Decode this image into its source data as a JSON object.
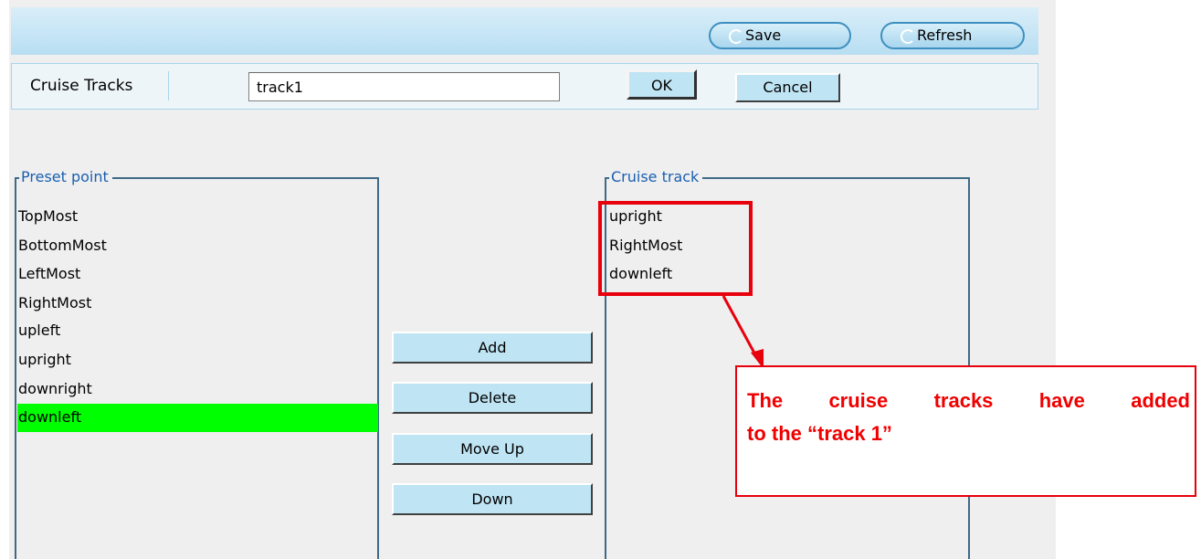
{
  "toolbar": {
    "save_label": "Save",
    "refresh_label": "Refresh"
  },
  "track_row": {
    "label": "Cruise Tracks",
    "input_value": "track1",
    "ok_label": "OK",
    "cancel_label": "Cancel"
  },
  "preset": {
    "legend": "Preset point",
    "items": [
      "TopMost",
      "BottomMost",
      "LeftMost",
      "RightMost",
      "upleft",
      "upright",
      "downright",
      "downleft"
    ],
    "selected_item": "downleft"
  },
  "actions": {
    "add_label": "Add",
    "delete_label": "Delete",
    "move_up_label": "Move Up",
    "down_label": "Down"
  },
  "cruise": {
    "legend": "Cruise track",
    "items": [
      "upright",
      "RightMost",
      "downleft"
    ]
  },
  "annotation": {
    "line1": "The cruise tracks have added",
    "line2": "to the “track 1”",
    "color": "#e8000c"
  },
  "colors": {
    "selected_bg": "#00ff00",
    "legend_text": "#1a5fb0",
    "button_bg": "#bfe4f3"
  }
}
